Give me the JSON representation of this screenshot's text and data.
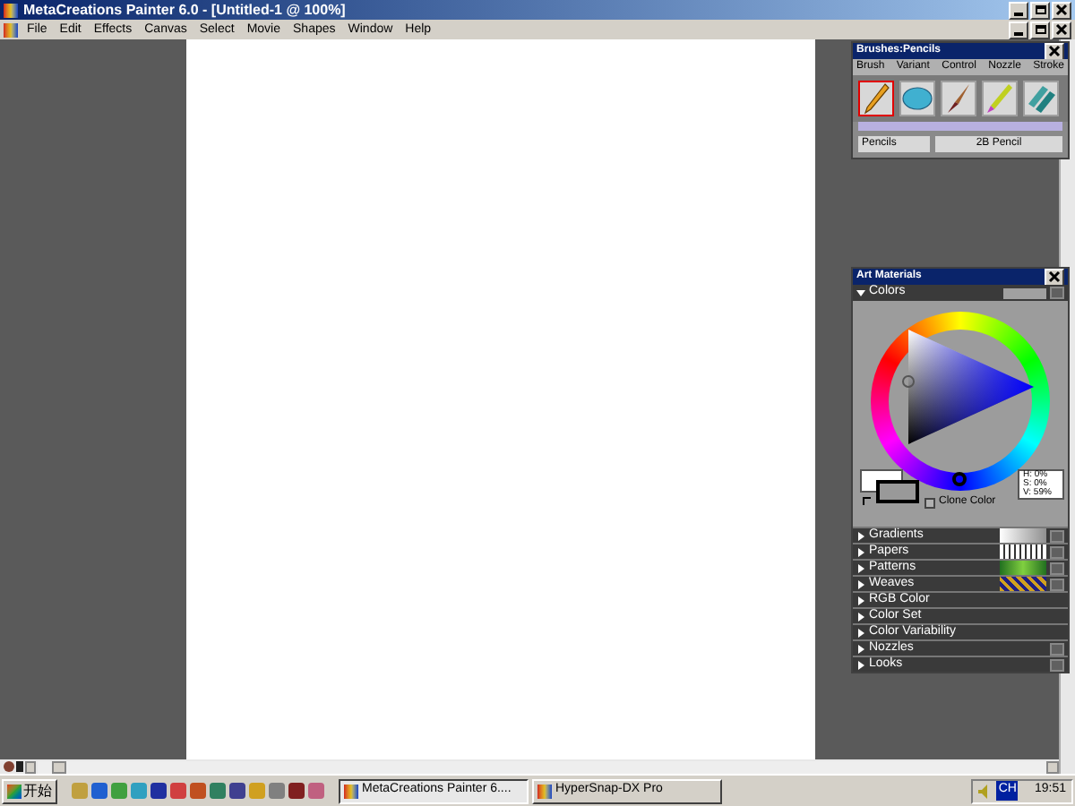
{
  "window": {
    "title": "MetaCreations Painter 6.0 - [Untitled-1 @ 100%]"
  },
  "menu": [
    "File",
    "Edit",
    "Effects",
    "Canvas",
    "Select",
    "Movie",
    "Shapes",
    "Window",
    "Help"
  ],
  "brushes": {
    "title": "Brushes:Pencils",
    "tabs": [
      "Brush",
      "Variant",
      "Control",
      "Nozzle",
      "Stroke"
    ],
    "icons": [
      {
        "kind": "pencil",
        "selected": true
      },
      {
        "kind": "chalk",
        "selected": false
      },
      {
        "kind": "brush",
        "selected": false
      },
      {
        "kind": "marker",
        "selected": false
      },
      {
        "kind": "pastel",
        "selected": false
      }
    ],
    "category": "Pencils",
    "variant": "2B Pencil"
  },
  "art_materials": {
    "title": "Art Materials",
    "colors": {
      "label": "Colors",
      "expanded": true,
      "clone_color": {
        "label": "Clone Color",
        "checked": false
      },
      "readout": [
        "H: 0%",
        "S: 0%",
        "V: 59%"
      ]
    },
    "sections": [
      {
        "label": "Gradients",
        "expanded": false,
        "kind": "gradient"
      },
      {
        "label": "Papers",
        "expanded": false,
        "kind": "paper"
      },
      {
        "label": "Patterns",
        "expanded": false,
        "kind": "pattern"
      },
      {
        "label": "Weaves",
        "expanded": false,
        "kind": "weave"
      },
      {
        "label": "RGB Color",
        "expanded": false,
        "kind": "plain"
      },
      {
        "label": "Color Set",
        "expanded": false,
        "kind": "plain"
      },
      {
        "label": "Color Variability",
        "expanded": false,
        "kind": "plain"
      },
      {
        "label": "Nozzles",
        "expanded": false,
        "kind": "menu"
      },
      {
        "label": "Looks",
        "expanded": false,
        "kind": "menu"
      }
    ]
  },
  "taskbar": {
    "start": "开始",
    "tasks": [
      {
        "label": "MetaCreations Painter 6....",
        "selected": true
      },
      {
        "label": "HyperSnap-DX Pro",
        "selected": false
      }
    ],
    "language": "CH",
    "clock": "19:51"
  }
}
